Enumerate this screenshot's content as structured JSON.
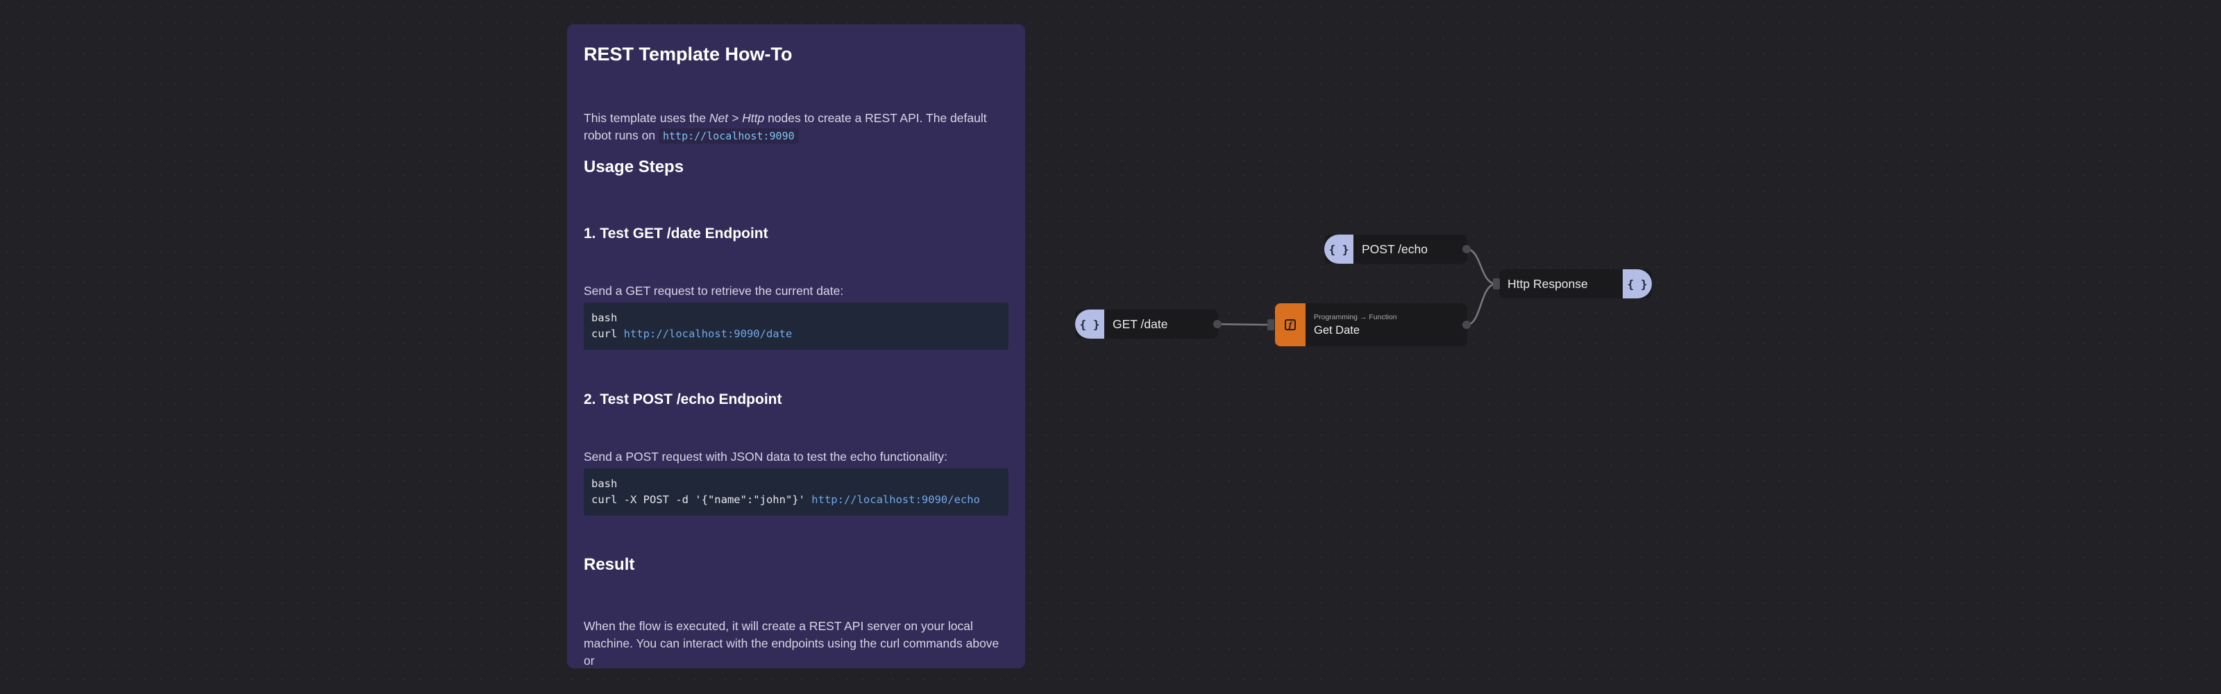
{
  "note": {
    "title": "REST Template How-To",
    "intro_pre": "This template uses the ",
    "intro_em": "Net > Http",
    "intro_mid": " nodes to create a REST API. The default robot runs on ",
    "intro_code": "http://localhost:9090",
    "usage_heading": "Usage Steps",
    "step1_heading": "1. Test GET /date Endpoint",
    "step1_text": "Send a GET request to retrieve the current date:",
    "step1_code_lang": "bash",
    "step1_code_cmd": "curl ",
    "step1_code_url": "http://localhost:9090/date",
    "step2_heading": "2. Test POST /echo Endpoint",
    "step2_text": "Send a POST request with JSON data to test the echo functionality:",
    "step2_code_lang": "bash",
    "step2_code_cmd": "curl -X POST -d '{\"name\":\"john\"}' ",
    "step2_code_url": "http://localhost:9090/echo",
    "result_heading": "Result",
    "result_text": "When the flow is executed, it will create a REST API server on your local machine. You can interact with the endpoints using the curl commands above or"
  },
  "nodes": {
    "post_echo": {
      "label": "POST /echo",
      "icon": "{ }"
    },
    "get_date": {
      "label": "GET /date",
      "icon": "{ }"
    },
    "get_date_func": {
      "crumb": "Programming → Function",
      "label": "Get Date",
      "icon": "f"
    },
    "http_response": {
      "label": "Http Response",
      "icon": "{ }"
    }
  },
  "colors": {
    "background": "#222126",
    "note_bg": "#342c58",
    "io_chip": "#b4bde6",
    "function_chip": "#d9701f",
    "node_bg": "#1a1a1c",
    "link_url": "#72a8e8"
  }
}
